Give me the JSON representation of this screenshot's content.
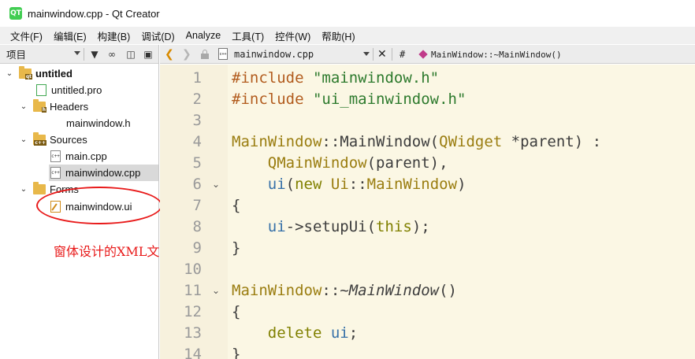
{
  "window": {
    "title": "mainwindow.cpp - Qt Creator",
    "icon_label": "QT"
  },
  "menubar": {
    "items": [
      "文件(F)",
      "编辑(E)",
      "构建(B)",
      "调试(D)",
      "Analyze",
      "工具(T)",
      "控件(W)",
      "帮助(H)"
    ]
  },
  "sidebar": {
    "combo_label": "项目",
    "tree": [
      {
        "label": "untitled",
        "bold": true
      },
      {
        "label": "untitled.pro"
      },
      {
        "label": "Headers"
      },
      {
        "label": "mainwindow.h"
      },
      {
        "label": "Sources"
      },
      {
        "label": "main.cpp"
      },
      {
        "label": "mainwindow.cpp"
      },
      {
        "label": "Forms"
      },
      {
        "label": "mainwindow.ui"
      }
    ]
  },
  "annotation": {
    "text": "窗体设计的XML文件",
    "color": "#e81919"
  },
  "editor_toolbar": {
    "file_name": "mainwindow.cpp",
    "hash_label": "#",
    "symbol": "MainWindow::~MainWindow()"
  },
  "editor": {
    "line_numbers": [
      "1",
      "2",
      "3",
      "4",
      "5",
      "6",
      "7",
      "8",
      "9",
      "10",
      "11",
      "12",
      "13",
      "14"
    ],
    "colors": {
      "gutter_bg": "#f7f1dd",
      "code_bg": "#fbf7e4",
      "preprocessor": "#b25c1e",
      "string": "#2d7a2d",
      "type": "#9a7d10",
      "member": "#3670a8",
      "keyword": "#808000"
    }
  }
}
